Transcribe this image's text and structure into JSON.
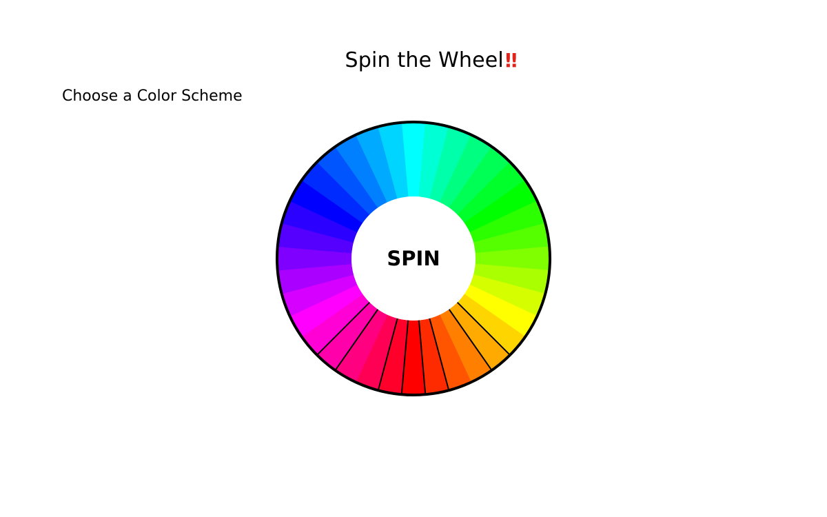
{
  "header": {
    "title": "Spin the Wheel",
    "emphasis": "‼"
  },
  "controls": {
    "scheme_label": "Choose a Color Scheme"
  },
  "wheel": {
    "spin_label": "SPIN",
    "segment_count": 36,
    "outline_color": "#000000",
    "hub_color": "#ffffff",
    "segment_colors": [
      "#00ffff",
      "#00ffd5",
      "#00ffaa",
      "#00ff80",
      "#00ff55",
      "#00ff2b",
      "#00ff00",
      "#2bff00",
      "#55ff00",
      "#80ff00",
      "#aaff00",
      "#d5ff00",
      "#ffff00",
      "#ffd500",
      "#ffaa00",
      "#ff8000",
      "#ff5500",
      "#ff2b00",
      "#ff0000",
      "#ff002b",
      "#ff0055",
      "#ff0080",
      "#ff00aa",
      "#ff00d5",
      "#ff00ff",
      "#d500ff",
      "#aa00ff",
      "#8000ff",
      "#5500ff",
      "#2b00ff",
      "#0000ff",
      "#002bff",
      "#0055ff",
      "#0080ff",
      "#00aaff",
      "#00d5ff"
    ],
    "divider_segments": [
      14,
      15,
      17,
      18,
      19,
      20,
      22,
      23
    ]
  }
}
